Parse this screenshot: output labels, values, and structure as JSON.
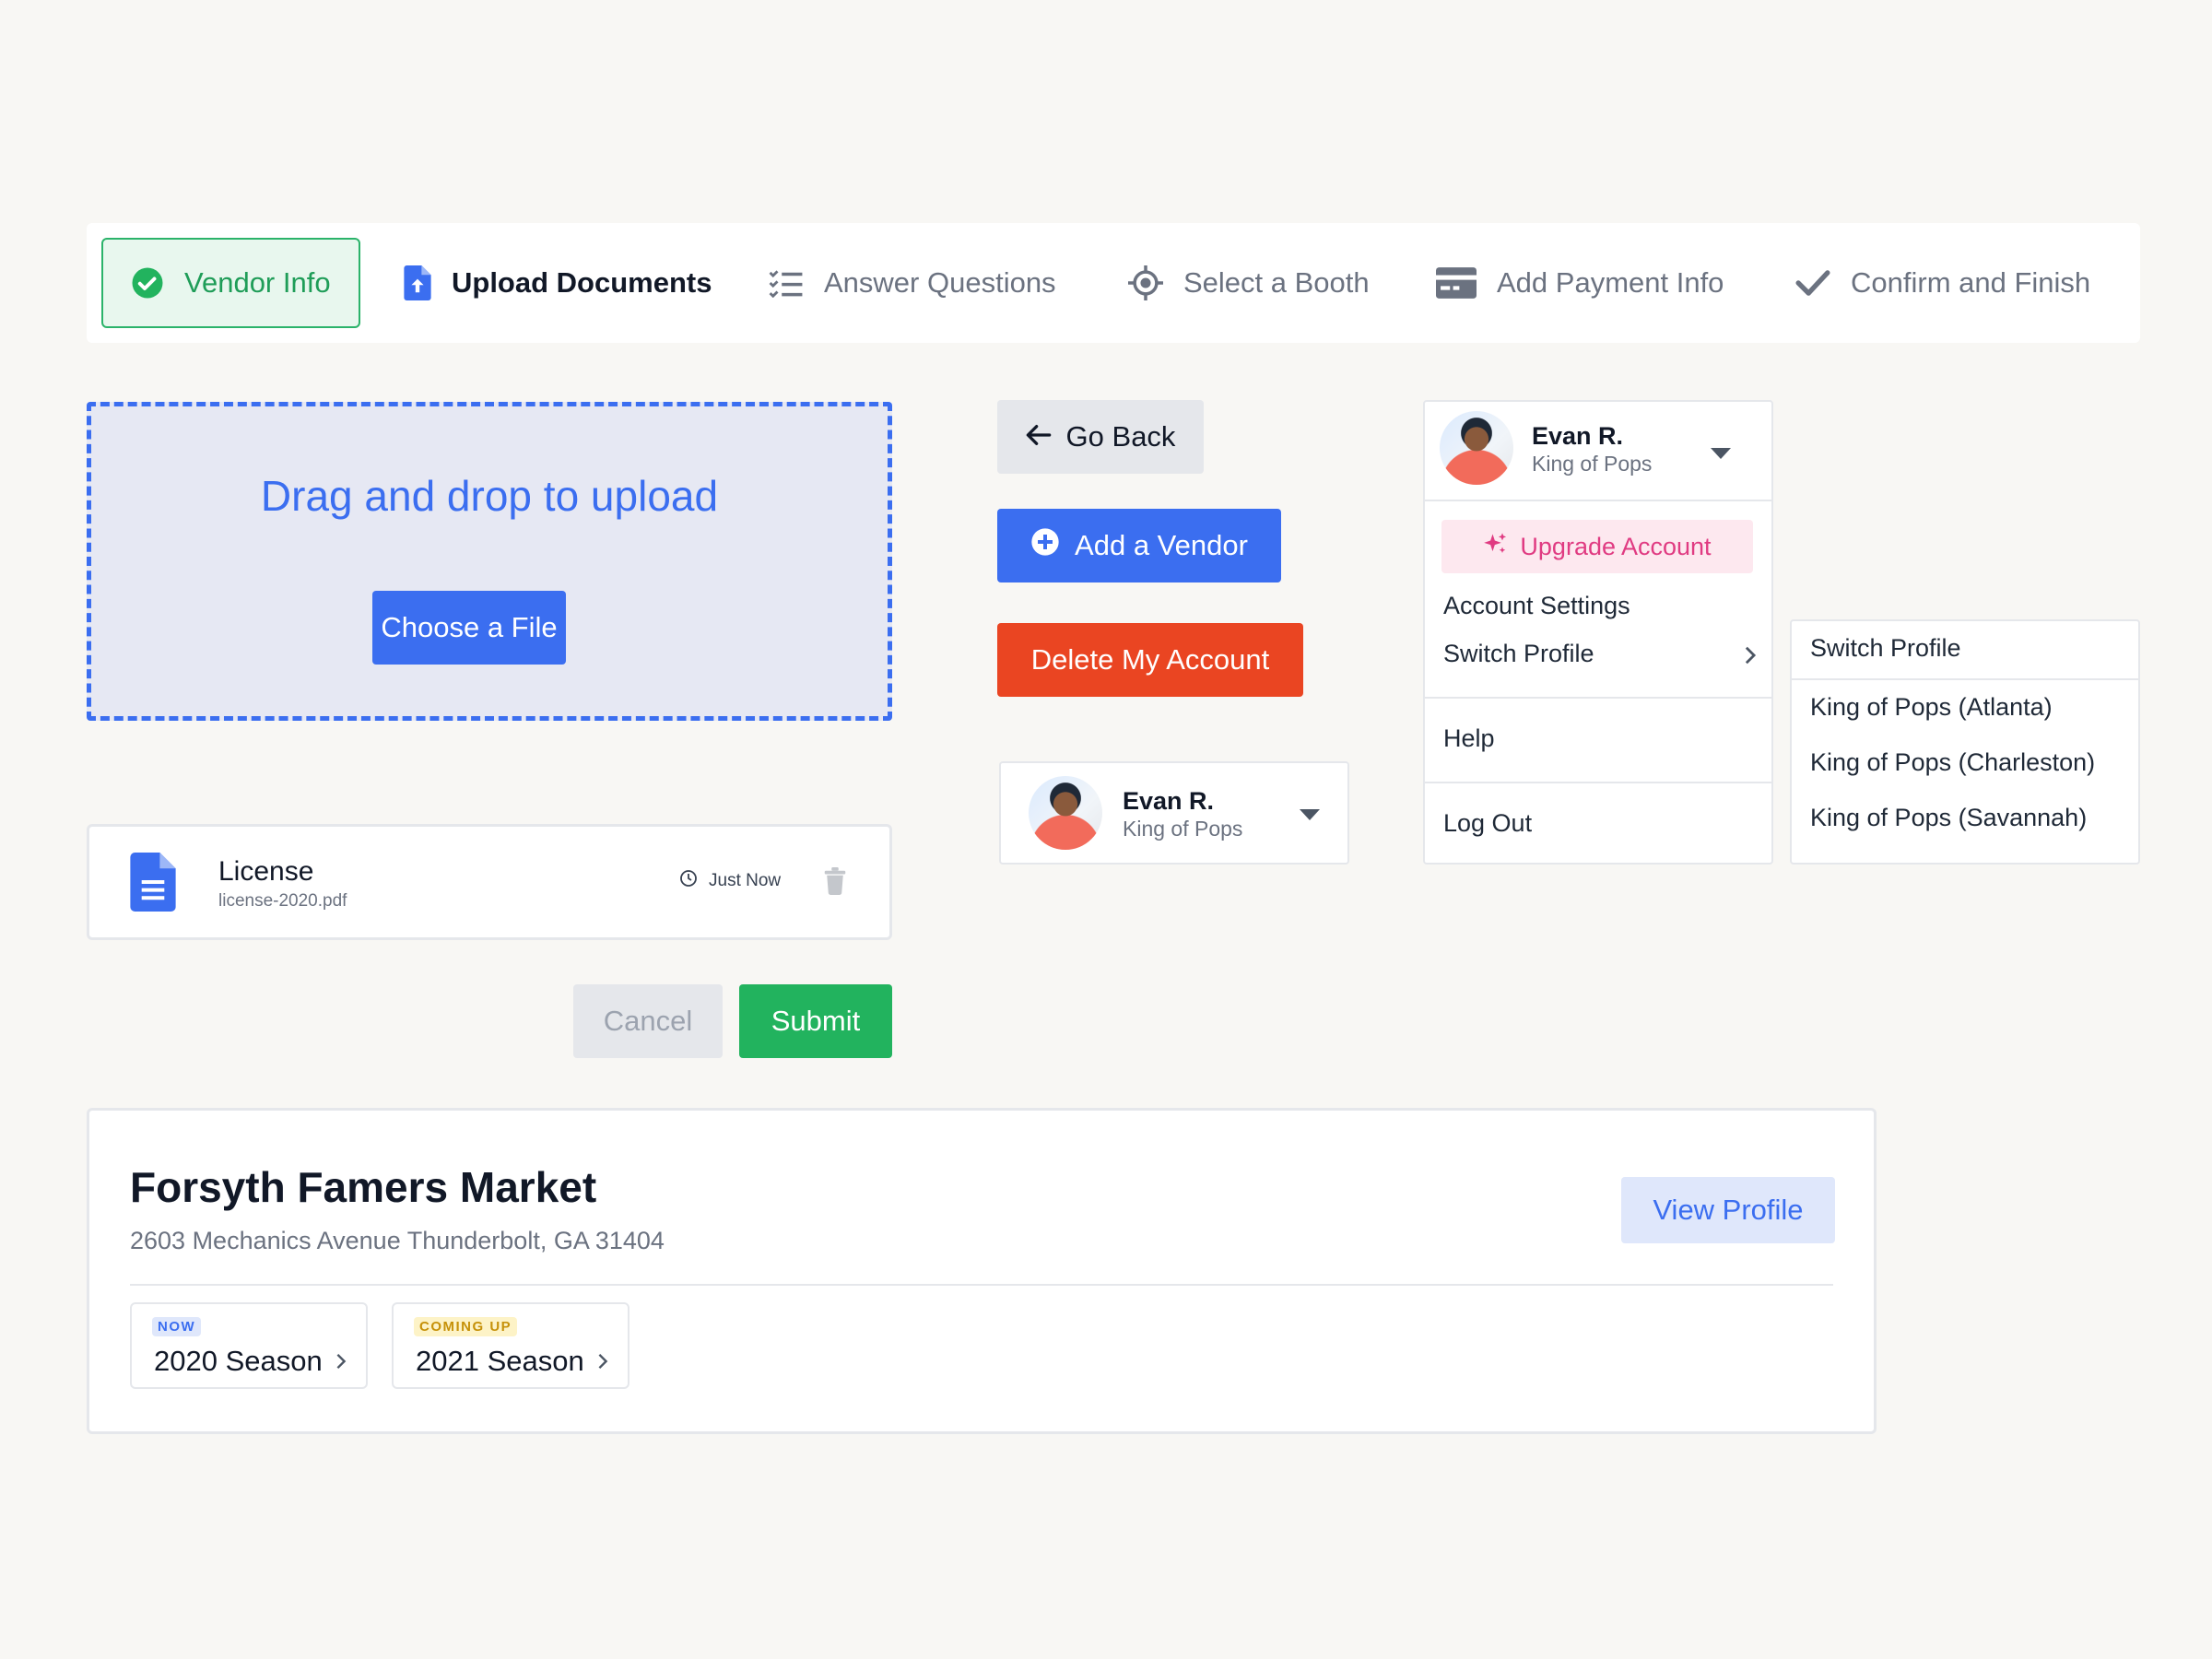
{
  "stepper": {
    "steps": [
      {
        "label": "Vendor Info",
        "state": "complete"
      },
      {
        "label": "Upload Documents",
        "state": "current"
      },
      {
        "label": "Answer Questions",
        "state": "upcoming"
      },
      {
        "label": "Select a Booth",
        "state": "upcoming"
      },
      {
        "label": "Add Payment Info",
        "state": "upcoming"
      },
      {
        "label": "Confirm and Finish",
        "state": "upcoming"
      }
    ]
  },
  "upload": {
    "title": "Drag and drop to upload",
    "choose_label": "Choose a File"
  },
  "file": {
    "name": "License",
    "filename": "license-2020.pdf",
    "time": "Just Now"
  },
  "form_actions": {
    "cancel_label": "Cancel",
    "submit_label": "Submit"
  },
  "buttons": {
    "go_back": "Go Back",
    "add_vendor": "Add a Vendor",
    "delete_account": "Delete My Account"
  },
  "profile": {
    "name": "Evan R.",
    "org": "King of Pops"
  },
  "menu": {
    "upgrade": "Upgrade Account",
    "account_settings": "Account Settings",
    "switch_profile": "Switch Profile",
    "help": "Help",
    "log_out": "Log Out"
  },
  "submenu": {
    "title": "Switch Profile",
    "items": [
      "King of Pops (Atlanta)",
      "King of Pops (Charleston)",
      "King of Pops (Savannah)"
    ]
  },
  "market": {
    "title": "Forsyth Famers Market",
    "address": "2603 Mechanics Avenue Thunderbolt, GA 31404",
    "view_profile": "View Profile",
    "seasons": [
      {
        "badge": "NOW",
        "label": "2020 Season"
      },
      {
        "badge": "COMING UP",
        "label": "2021 Season"
      }
    ]
  },
  "colors": {
    "accent_blue": "#3b6ef0",
    "success_green": "#22b35e",
    "danger_red": "#ea4522",
    "upgrade_pink": "#e03b82"
  }
}
